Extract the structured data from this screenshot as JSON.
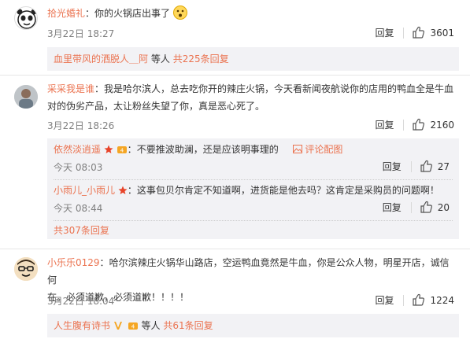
{
  "comments": [
    {
      "user": "拾光婚礼",
      "text": "你的火锅店出事了",
      "time": "3月22日 18:27",
      "reply": "回复",
      "likes": "3601",
      "sub_summary": {
        "user": "血里带风的洒脱人＿阿",
        "mid": "等人",
        "count": "共225条回复"
      }
    },
    {
      "user": "采采我是谁",
      "text_line1": "我是哈尔滨人，总去吃你开的辣庄火锅，今天看新闻夜航说你的店用的鸭血全是牛血",
      "text_line2": "对的伪劣产品，太让粉丝失望了你，真是恶心死了。",
      "time": "3月22日 18:26",
      "reply": "回复",
      "likes": "2160",
      "replies": [
        {
          "user": "依然淡逍遥",
          "text": "不要推波助澜，还是应该明事理的",
          "extra": "评论配图",
          "time": "今天 08:03",
          "reply": "回复",
          "likes": "27"
        },
        {
          "user": "小雨儿_小雨儿",
          "text": "这事包贝尔肯定不知道啊，进货能是他去吗？这肯定是采购员的问题啊！",
          "time": "今天 08:44",
          "reply": "回复",
          "likes": "20"
        }
      ],
      "more": "共307条回复"
    },
    {
      "user": "小乐乐0129",
      "text_line1": "哈尔滨辣庄火锅华山路店，空运鸭血竟然是牛血，你是公众人物，明星开店，诚信何",
      "text_line2": "在。必须道歉，必须道歉！！！！",
      "time": "3月22日 18:04",
      "reply": "回复",
      "likes": "1224",
      "sub_summary": {
        "user": "人生腹有诗书",
        "mid": "等人",
        "count": "共61条回复"
      }
    }
  ],
  "colors": {
    "link": "#eb7350",
    "meta": "#808080",
    "panel": "#f2f2f5"
  }
}
